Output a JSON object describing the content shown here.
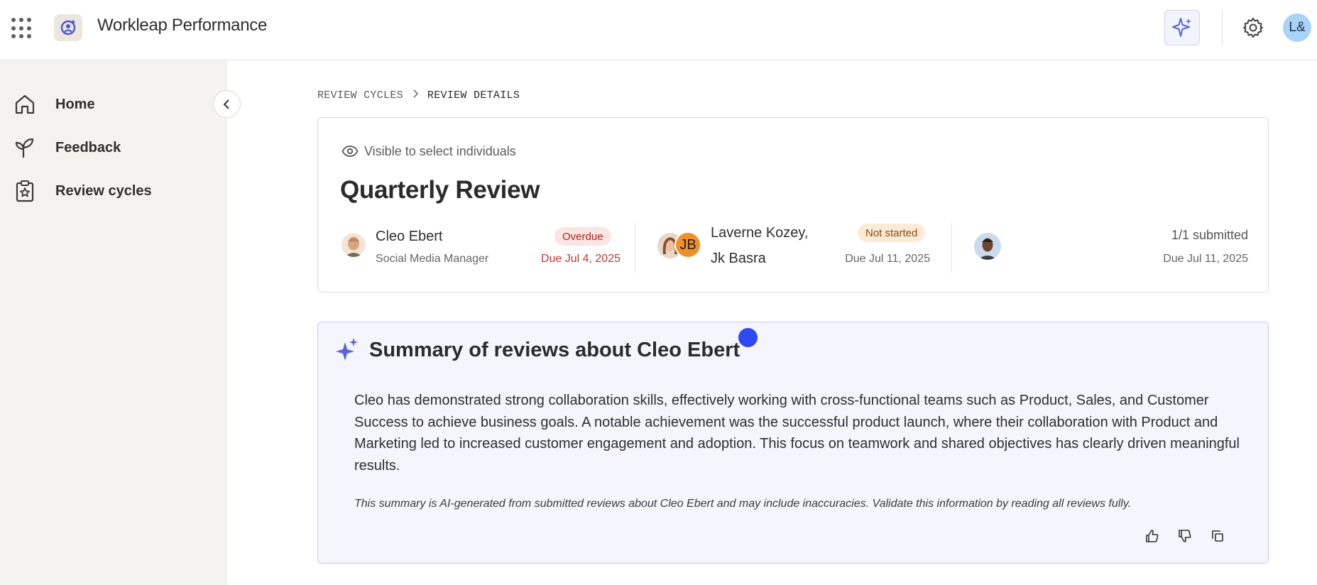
{
  "header": {
    "app_title": "Workleap Performance",
    "user_initials": "L&",
    "icons": {
      "apps": "app-grid-icon",
      "logo": "workleap-logo-icon",
      "ai": "sparkle-icon",
      "settings": "gear-icon"
    },
    "accent_color": "#5b63d9"
  },
  "sidebar": {
    "items": [
      {
        "label": "Home",
        "icon": "home-icon"
      },
      {
        "label": "Feedback",
        "icon": "sprout-icon"
      },
      {
        "label": "Review cycles",
        "icon": "clipboard-star-icon"
      }
    ],
    "collapse_icon": "chevron-left-icon"
  },
  "breadcrumb": {
    "items": [
      "REVIEW CYCLES",
      "REVIEW DETAILS"
    ],
    "separator_icon": "chevron-right-icon"
  },
  "review": {
    "visibility": "Visible to select individuals",
    "title": "Quarterly Review",
    "reviewee": {
      "name": "Cleo Ebert",
      "role": "Social Media Manager",
      "status": "Overdue",
      "due": "Due Jul 4, 2025"
    },
    "reviewers": {
      "names_line1": "Laverne Kozey,",
      "names_line2": "Jk Basra",
      "initials": "JB",
      "status": "Not started",
      "due": "Due Jul 11, 2025"
    },
    "peers": {
      "submitted": "1/1 submitted",
      "due": "Due Jul 11, 2025"
    },
    "status_colors": {
      "overdue": "#b3261e",
      "not_started": "#8a4a10"
    }
  },
  "summary": {
    "title": "Summary of reviews about Cleo Ebert",
    "body": "Cleo has demonstrated strong collaboration skills, effectively working with cross-functional teams such as Product, Sales, and Customer Success to achieve business goals. A notable achievement was the successful product launch, where their collaboration with Product and Marketing led to increased customer engagement and adoption. This focus on teamwork and shared objectives has clearly driven meaningful results.",
    "disclaimer": "This summary is AI-generated from submitted reviews about Cleo Ebert and may include inaccuracies. Validate this information by reading all reviews fully.",
    "actions": [
      "thumbs-up-icon",
      "thumbs-down-icon",
      "copy-icon"
    ]
  }
}
